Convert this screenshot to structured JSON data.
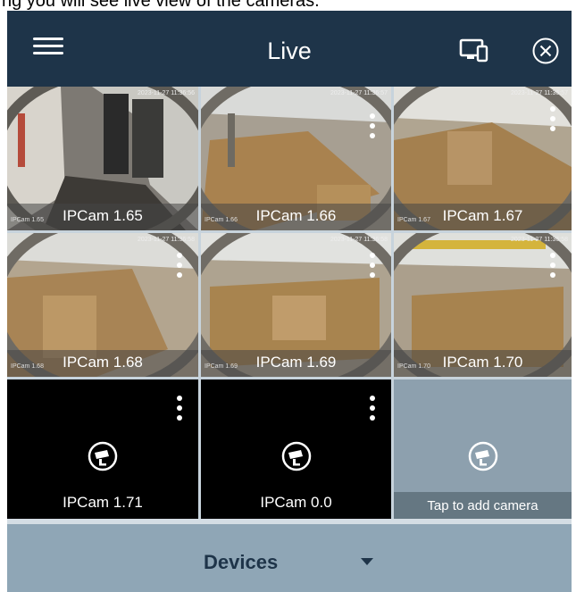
{
  "caption": "ng you will see live view of the cameras.",
  "header": {
    "title": "Live"
  },
  "tiles": [
    {
      "name": "IPCam 1.65",
      "tag": "IPCam 1.65",
      "timestamp": "2023-11-27 11:36:56"
    },
    {
      "name": "IPCam 1.66",
      "tag": "IPCam 1.66",
      "timestamp": "2023-11-27 11:36:57"
    },
    {
      "name": "IPCam 1.67",
      "tag": "IPCam 1.67",
      "timestamp": "2023-11-27 11:36:57"
    },
    {
      "name": "IPCam 1.68",
      "tag": "IPCam 1.68",
      "timestamp": "2023-11-27 11:36:58"
    },
    {
      "name": "IPCam 1.69",
      "tag": "IPCam 1.69",
      "timestamp": "2023-11-27 11:36:58"
    },
    {
      "name": "IPCam 1.70",
      "tag": "IPCam 1.70",
      "timestamp": "2023-11-27 11:36:58"
    },
    {
      "name": "IPCam 1.71"
    },
    {
      "name": "IPCam 0.0"
    },
    {
      "name": "Tap to add camera"
    }
  ],
  "footer": {
    "devices_label": "Devices"
  },
  "icons": {
    "menu": "hamburger-menu-icon",
    "screen": "screen-device-icon",
    "close": "close-circle-icon",
    "camera": "camera-icon",
    "more": "vertical-dots-icon",
    "dropdown": "caret-down-icon"
  },
  "colors": {
    "header_bg": "#1e3449",
    "selected_outline": "#48c34a",
    "footer_bg": "#8fa6b6"
  }
}
